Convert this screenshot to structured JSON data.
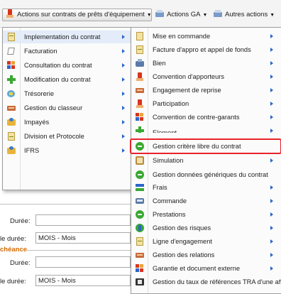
{
  "toolbar": {
    "btn_contracts": "Actions sur contrats de prêts d'équipement",
    "btn_ga": "Actions GA",
    "btn_other": "Autres actions"
  },
  "menu_main": {
    "items": [
      {
        "label": "Implementation du contrat",
        "icon": "contract-icon"
      },
      {
        "label": "Facturation",
        "icon": "invoice-icon"
      },
      {
        "label": "Consultation du contrat",
        "icon": "consult-icon"
      },
      {
        "label": "Modification du contrat",
        "icon": "plus-icon"
      },
      {
        "label": "Trésorerie",
        "icon": "treasury-icon"
      },
      {
        "label": "Gestion du classeur",
        "icon": "binder-icon"
      },
      {
        "label": "Impayés",
        "icon": "unpaid-icon"
      },
      {
        "label": "Division et Protocole",
        "icon": "division-icon"
      },
      {
        "label": "IFRS",
        "icon": "ifrs-icon"
      }
    ]
  },
  "menu_sub": {
    "items": [
      {
        "label": "Mise en commande"
      },
      {
        "label": "Facture d'appro et appel de fonds"
      },
      {
        "label": "Bien"
      },
      {
        "label": "Convention d'apporteurs"
      },
      {
        "label": "Engagement de reprise"
      },
      {
        "label": "Participation"
      },
      {
        "label": "Convention de contre-garants"
      },
      {
        "label": "Element"
      },
      {
        "label": "Gestion critère libre du contrat"
      },
      {
        "label": "Simulation"
      },
      {
        "label": "Gestion données génériques du contrat"
      },
      {
        "label": "Frais"
      },
      {
        "label": "Commande"
      },
      {
        "label": "Prestations"
      },
      {
        "label": "Gestion des risques"
      },
      {
        "label": "Ligne d'engagement"
      },
      {
        "label": "Gestion des relations"
      },
      {
        "label": "Garantie et document externe"
      },
      {
        "label": "Gestion du taux de références TRA d'une affaire"
      }
    ]
  },
  "form": {
    "duree_label": "Durée:",
    "unite_label": "le durée:",
    "unite_value": "MOIS - Mois",
    "section_legend": "chéance",
    "duree2_label": "Durée:",
    "unite2_label": "le durée:",
    "unite2_value": "MOIS - Mois"
  },
  "colors": {
    "highlight_border": "#e8232a",
    "submenu_arrow": "#2a66c8",
    "legend": "#d66a00"
  }
}
